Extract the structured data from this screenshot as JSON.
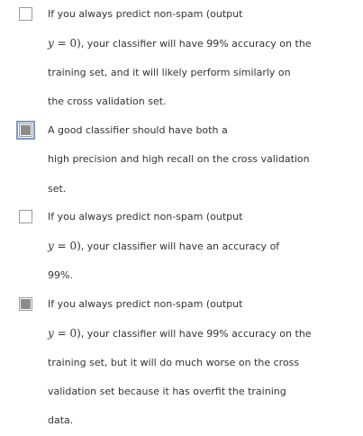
{
  "options": [
    {
      "checked": false,
      "focused": false,
      "lines": [
        "If you always predict non-spam (output",
        {
          "math_var": "y",
          "math_rest": " = 0)",
          "text": ", your classifier will have 99% accuracy on the"
        },
        "training set, and it will likely perform similarly on",
        "the cross validation set."
      ]
    },
    {
      "checked": true,
      "focused": true,
      "lines": [
        "A good classifier should have both a",
        "high precision and high recall on the cross validation",
        "set."
      ]
    },
    {
      "checked": false,
      "focused": false,
      "lines": [
        "If you always predict non-spam (output",
        {
          "math_var": "y",
          "math_rest": " = 0)",
          "text": ", your classifier will have an accuracy of"
        },
        "99%."
      ]
    },
    {
      "checked": true,
      "focused": false,
      "lines": [
        "If you always predict non-spam (output",
        {
          "math_var": "y",
          "math_rest": " = 0)",
          "text": ", your classifier will have 99% accuracy on the"
        },
        "training set, but it will do much worse on the cross",
        "validation set because it has overfit the training",
        "data."
      ]
    }
  ]
}
